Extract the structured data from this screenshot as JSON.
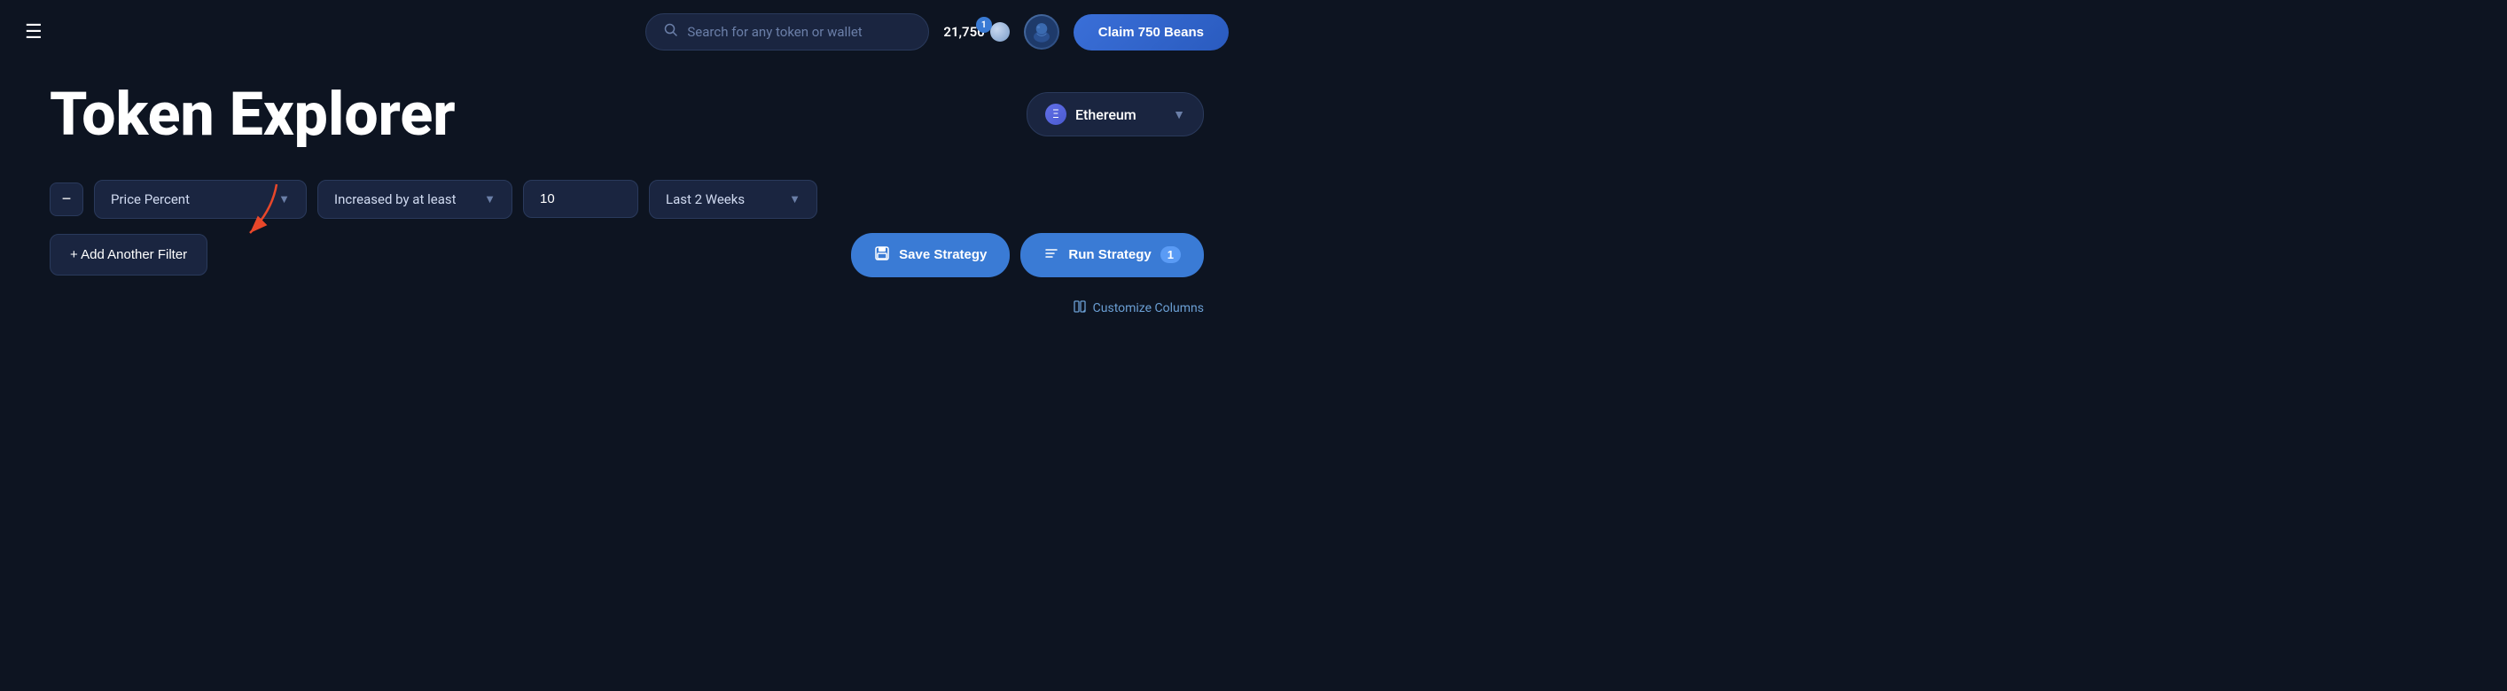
{
  "navbar": {
    "hamburger_label": "☰",
    "search_placeholder": "Search for any token or wallet",
    "notification_count": "1",
    "beans_count": "21,750",
    "claim_button_label": "Claim 750 Beans"
  },
  "page": {
    "title": "Token Explorer",
    "network": {
      "name": "Ethereum",
      "icon": "Ξ"
    }
  },
  "filter": {
    "remove_label": "−",
    "type_label": "Price Percent",
    "condition_label": "Increased by at least",
    "value": "10",
    "timeframe_label": "Last 2 Weeks",
    "add_filter_label": "+ Add Another Filter",
    "save_strategy_label": "Save Strategy",
    "run_strategy_label": "Run Strategy",
    "run_badge": "1",
    "filter_icon": "💾",
    "run_icon": "≡"
  },
  "customize": {
    "label": "Customize Columns"
  }
}
